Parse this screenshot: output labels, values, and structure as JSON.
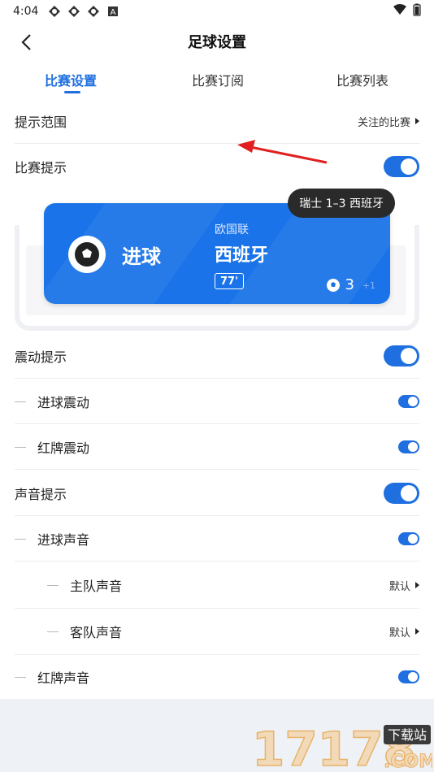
{
  "status": {
    "time": "4:04"
  },
  "nav": {
    "title": "足球设置"
  },
  "tabs": [
    {
      "label": "比赛设置",
      "active": true
    },
    {
      "label": "比赛订阅",
      "active": false
    },
    {
      "label": "比赛列表",
      "active": false
    }
  ],
  "settings": {
    "scope": {
      "label": "提示范围",
      "value": "关注的比赛"
    },
    "match_alert": {
      "label": "比赛提示",
      "on": true
    },
    "vibrate": {
      "label": "震动提示",
      "on": true
    },
    "goal_vibrate": {
      "label": "进球震动",
      "on": true
    },
    "red_vibrate": {
      "label": "红牌震动",
      "on": true
    },
    "sound": {
      "label": "声音提示",
      "on": true
    },
    "goal_sound": {
      "label": "进球声音",
      "on": true
    },
    "home_sound": {
      "label": "主队声音",
      "value": "默认"
    },
    "away_sound": {
      "label": "客队声音",
      "value": "默认"
    },
    "red_sound": {
      "label": "红牌声音",
      "on": true
    }
  },
  "preview": {
    "goal_text": "进球",
    "league": "欧国联",
    "team": "西班牙",
    "minute": "77'",
    "goals": "3",
    "plus": "+1",
    "score_tip": "瑞士 1–3 西班牙"
  },
  "watermark": {
    "number": "17178",
    "site": "下载站",
    "suffix": ".COM"
  },
  "colors": {
    "accent": "#1f6fe0",
    "notif_bg": "#1a73e8",
    "arrow": "#e02020"
  }
}
